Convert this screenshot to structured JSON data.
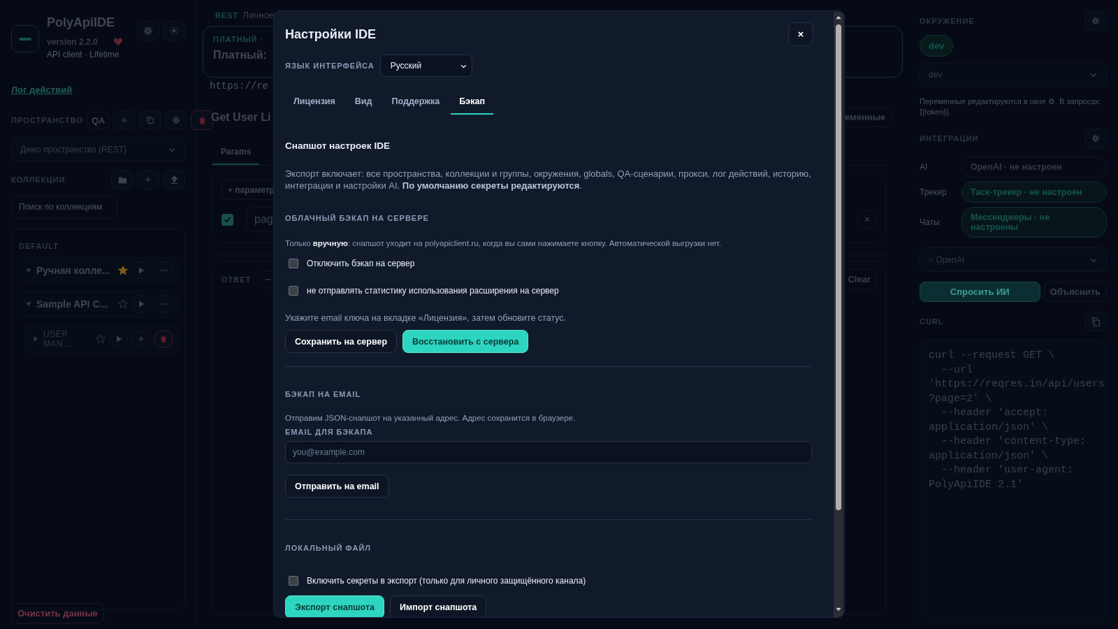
{
  "sidebar": {
    "app_name": "PolyApiIDE",
    "version": "version 2.2.0",
    "subtitle": "API client · Lifetime",
    "log_link": "Лог действий",
    "workspace_label": "ПРОСТРАНСТВО",
    "workspace_badge": "QA",
    "workspace_select": "Демо пространство (REST)",
    "collections_label": "КОЛЛЕКЦИИ",
    "search_placeholder": "Поиск по коллекциям",
    "group_label": "DEFAULT",
    "collections": [
      {
        "name": "Ручная колле...",
        "starred": true,
        "expanded": true
      },
      {
        "name": "Sample API C...",
        "starred": false,
        "expanded": true,
        "children": [
          {
            "name": "USER MAN...",
            "starred": false,
            "expanded": false
          }
        ]
      }
    ],
    "clear_button": "Очистить данные"
  },
  "request": {
    "protocol": "REST",
    "name": "Личное",
    "plan_label": "ПЛАТНЫЙ ·",
    "plan_title": "Платный:",
    "url": "https://re",
    "title": "Get User Li",
    "vars_button": "еменные",
    "tabs": [
      {
        "label": "Params",
        "selected": true
      }
    ],
    "add_param": "+ параметр",
    "params": [
      {
        "key": "pag",
        "enabled": true
      }
    ],
    "response_label": "ОТВЕТ",
    "clear_button": "Clear"
  },
  "environment": {
    "label": "ОКРУЖЕНИЕ",
    "chip": "dev",
    "select": "dev",
    "hint": "Переменные редактируются в окне ⚙. В запросах: {{token}}.",
    "integrations_label": "ИНТЕГРАЦИИ",
    "integrations": [
      {
        "label": "AI",
        "status": "OpenAI · не настроен",
        "highlighted": false
      },
      {
        "label": "Трекер",
        "status": "Таск-трекер · не настроен",
        "highlighted": true
      },
      {
        "label": "Чаты",
        "status": "Мессенджеры · не настроены",
        "highlighted": true
      }
    ],
    "model_select": "○ OpenAI",
    "ask_button": "Спросить ИИ",
    "explain_button": "Объяснить",
    "curl_label": "CURL",
    "curl_lines": [
      "curl --request GET \\",
      "  --url",
      "'https://reqres.in/api/users",
      "?page=2' \\",
      "  --header 'accept:",
      "application/json' \\",
      "  --header 'content-type:",
      "application/json' \\",
      "  --header 'user-agent:",
      "PolyApiIDE 2.1'"
    ]
  },
  "modal": {
    "title": "Настройки IDE",
    "language_label": "ЯЗЫК ИНТЕРФЕЙСА",
    "language": "Русский",
    "tabs": [
      {
        "label": "Лицензия",
        "selected": false
      },
      {
        "label": "Вид",
        "selected": false
      },
      {
        "label": "Поддержка",
        "selected": false
      },
      {
        "label": "Бэкап",
        "selected": true
      }
    ],
    "snapshot_title": "Снапшот настроек IDE",
    "snapshot_text": "Экспорт включает: все пространства, коллекции и группы, окружения, globals, QA-сценарии, прокси, лог действий, историю, интеграции и настройки AI. **По умолчанию секреты редактируются**.",
    "cloud": {
      "heading": "ОБЛАЧНЫЙ БЭКАП НА СЕРВЕРЕ",
      "note": "Только **вручную**: снапшот уходит на polyapiclient.ru, когда вы сами нажимаете кнопку. Автоматической выгрузки нет.",
      "options": [
        {
          "label": "Отключить бэкап на сервер",
          "checked": false
        },
        {
          "label": "не отправлять статистику использования расширения на сервер",
          "checked": false
        }
      ],
      "hint": "Укажите email ключа на вкладке «Лицензия», затем обновите статус.",
      "buttons": [
        {
          "label": "Сохранить на сервер",
          "primary": false
        },
        {
          "label": "Восстановить с сервера",
          "primary": true
        }
      ]
    },
    "email": {
      "heading": "БЭКАП НА EMAIL",
      "note": "Отправим JSON-снапшот на указанный адрес. Адрес сохранится в браузере.",
      "field_label": "EMAIL ДЛЯ БЭКАПА",
      "placeholder": "you@example.com",
      "button": "Отправить на email"
    },
    "local": {
      "heading": "ЛОКАЛЬНЫЙ ФАЙЛ",
      "options": [
        {
          "label": "Включить секреты в экспорт (только для личного защищённого канала)",
          "checked": false
        }
      ],
      "buttons": [
        {
          "label": "Экспорт снапшота",
          "primary": true
        },
        {
          "label": "Импорт снапшота",
          "primary": false
        }
      ]
    }
  }
}
